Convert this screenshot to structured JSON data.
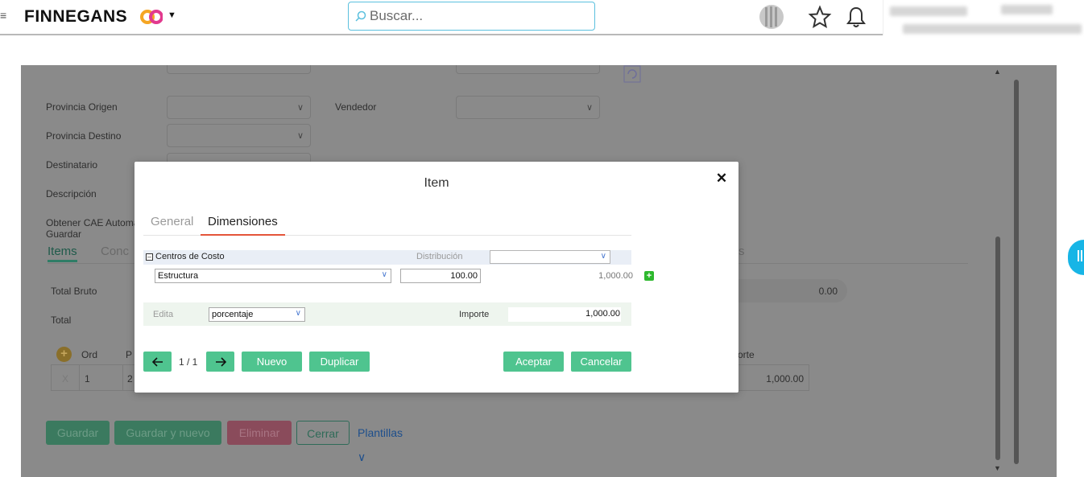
{
  "header": {
    "brand": "FINNEGANS",
    "search_placeholder": "Buscar..."
  },
  "background_form": {
    "labels": {
      "provincia_origen": "Provincia Origen",
      "provincia_destino": "Provincia Destino",
      "destinatario": "Destinatario",
      "descripcion": "Descripción",
      "obtener_cae": "Obtener CAE Automa",
      "guardar_sub": "Guardar",
      "vendedor": "Vendedor",
      "total_bruto": "Total Bruto",
      "total": "Total",
      "total_bruto_value": "0.00"
    },
    "tabs": {
      "items": "Items",
      "conc": "Conc",
      "s_tail": "s"
    },
    "grid": {
      "col_ord": "Ord",
      "col_p": "P",
      "col_orte": "orte",
      "row_ord": "1",
      "row_p": "2",
      "row_x": "X",
      "row_amount": "1,000.00"
    },
    "buttons": {
      "guardar": "Guardar",
      "guardar_y_nuevo": "Guardar y nuevo",
      "eliminar": "Eliminar",
      "cerrar": "Cerrar",
      "plantillas": "Plantillas"
    }
  },
  "modal": {
    "title": "Item",
    "tabs": {
      "general": "General",
      "dimensiones": "Dimensiones"
    },
    "centros_de_costo": "Centros de Costo",
    "distribucion_label": "Distribución",
    "estructura_value": "Estructura",
    "percentage_value": "100.00",
    "line_amount": "1,000.00",
    "edita_label": "Edita",
    "edita_value": "porcentaje",
    "importe_label": "Importe",
    "importe_value": "1,000.00",
    "pager": "1 / 1",
    "buttons": {
      "nuevo": "Nuevo",
      "duplicar": "Duplicar",
      "aceptar": "Aceptar",
      "cancelar": "Cancelar"
    }
  },
  "colors": {
    "accent_green": "#4fc48f",
    "tab_underline": "#e4553a",
    "search_border": "#5bc0de",
    "side_tab": "#17b5e6"
  }
}
